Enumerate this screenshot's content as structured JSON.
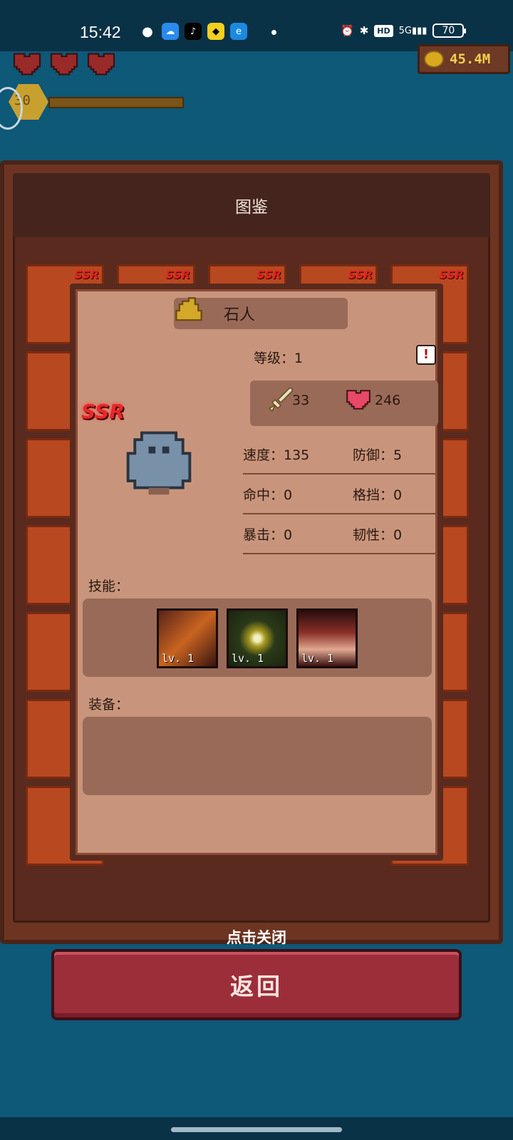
{
  "statusbar": {
    "time": "15:42",
    "apps": [
      "wechat",
      "weather",
      "tiktok",
      "game-app",
      "browser"
    ],
    "network": "5G",
    "badge": "HD",
    "battery": "70"
  },
  "hud": {
    "hearts": 3,
    "gold": "45.4M",
    "player_level": "30",
    "xp_fraction": 1.0
  },
  "album": {
    "title": "图鉴",
    "cards": [
      {
        "rarity": "SSR"
      },
      {
        "rarity": "SSR"
      },
      {
        "rarity": "SSR"
      },
      {
        "rarity": "SSR"
      },
      {
        "rarity": "SSR"
      }
    ]
  },
  "detail": {
    "name": "石人",
    "level_label": "等级：1",
    "rarity": "SSR",
    "attack": "33",
    "hp": "246",
    "stats": [
      [
        "速度：135",
        "防御：5"
      ],
      [
        "命中：0",
        "格挡：0"
      ],
      [
        "暴击：0",
        "韧性：0"
      ]
    ],
    "skills_label": "技能：",
    "skills": [
      {
        "level": "lv. 1",
        "icon": "fire-fist-icon"
      },
      {
        "level": "lv. 1",
        "icon": "gold-rune-icon"
      },
      {
        "level": "lv. 1",
        "icon": "spikes-icon"
      }
    ],
    "equipment_label": "装备："
  },
  "close_hint": "点击关闭",
  "back_button": "返回",
  "colors": {
    "background": "#0e5878",
    "panel": "#6e3422",
    "modal": "#c8957c",
    "button": "#9c2e3a",
    "ssr": "#e82828"
  }
}
